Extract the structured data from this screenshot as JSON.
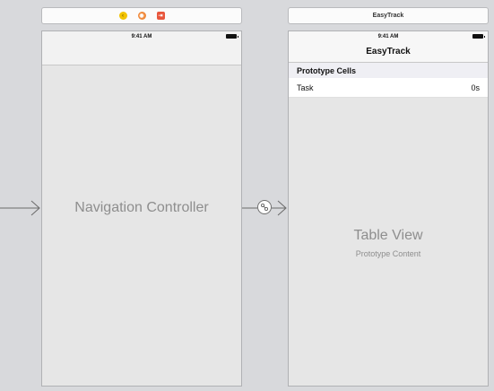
{
  "left_scene": {
    "dock_icons": [
      "view-controller-icon",
      "first-responder-icon",
      "exit-icon"
    ]
  },
  "right_scene": {
    "title": "EasyTrack"
  },
  "nav_controller": {
    "status_time": "9:41 AM",
    "label": "Navigation Controller"
  },
  "table_controller": {
    "status_time": "9:41 AM",
    "nav_title": "EasyTrack",
    "section_header": "Prototype Cells",
    "cell": {
      "title": "Task",
      "detail": "0s"
    },
    "table_label": "Table View",
    "table_sublabel": "Prototype Content"
  },
  "colors": {
    "canvas": "#d8d9dc",
    "device_bg": "#e6e6e6",
    "placeholder_text": "#8e8e8e"
  }
}
